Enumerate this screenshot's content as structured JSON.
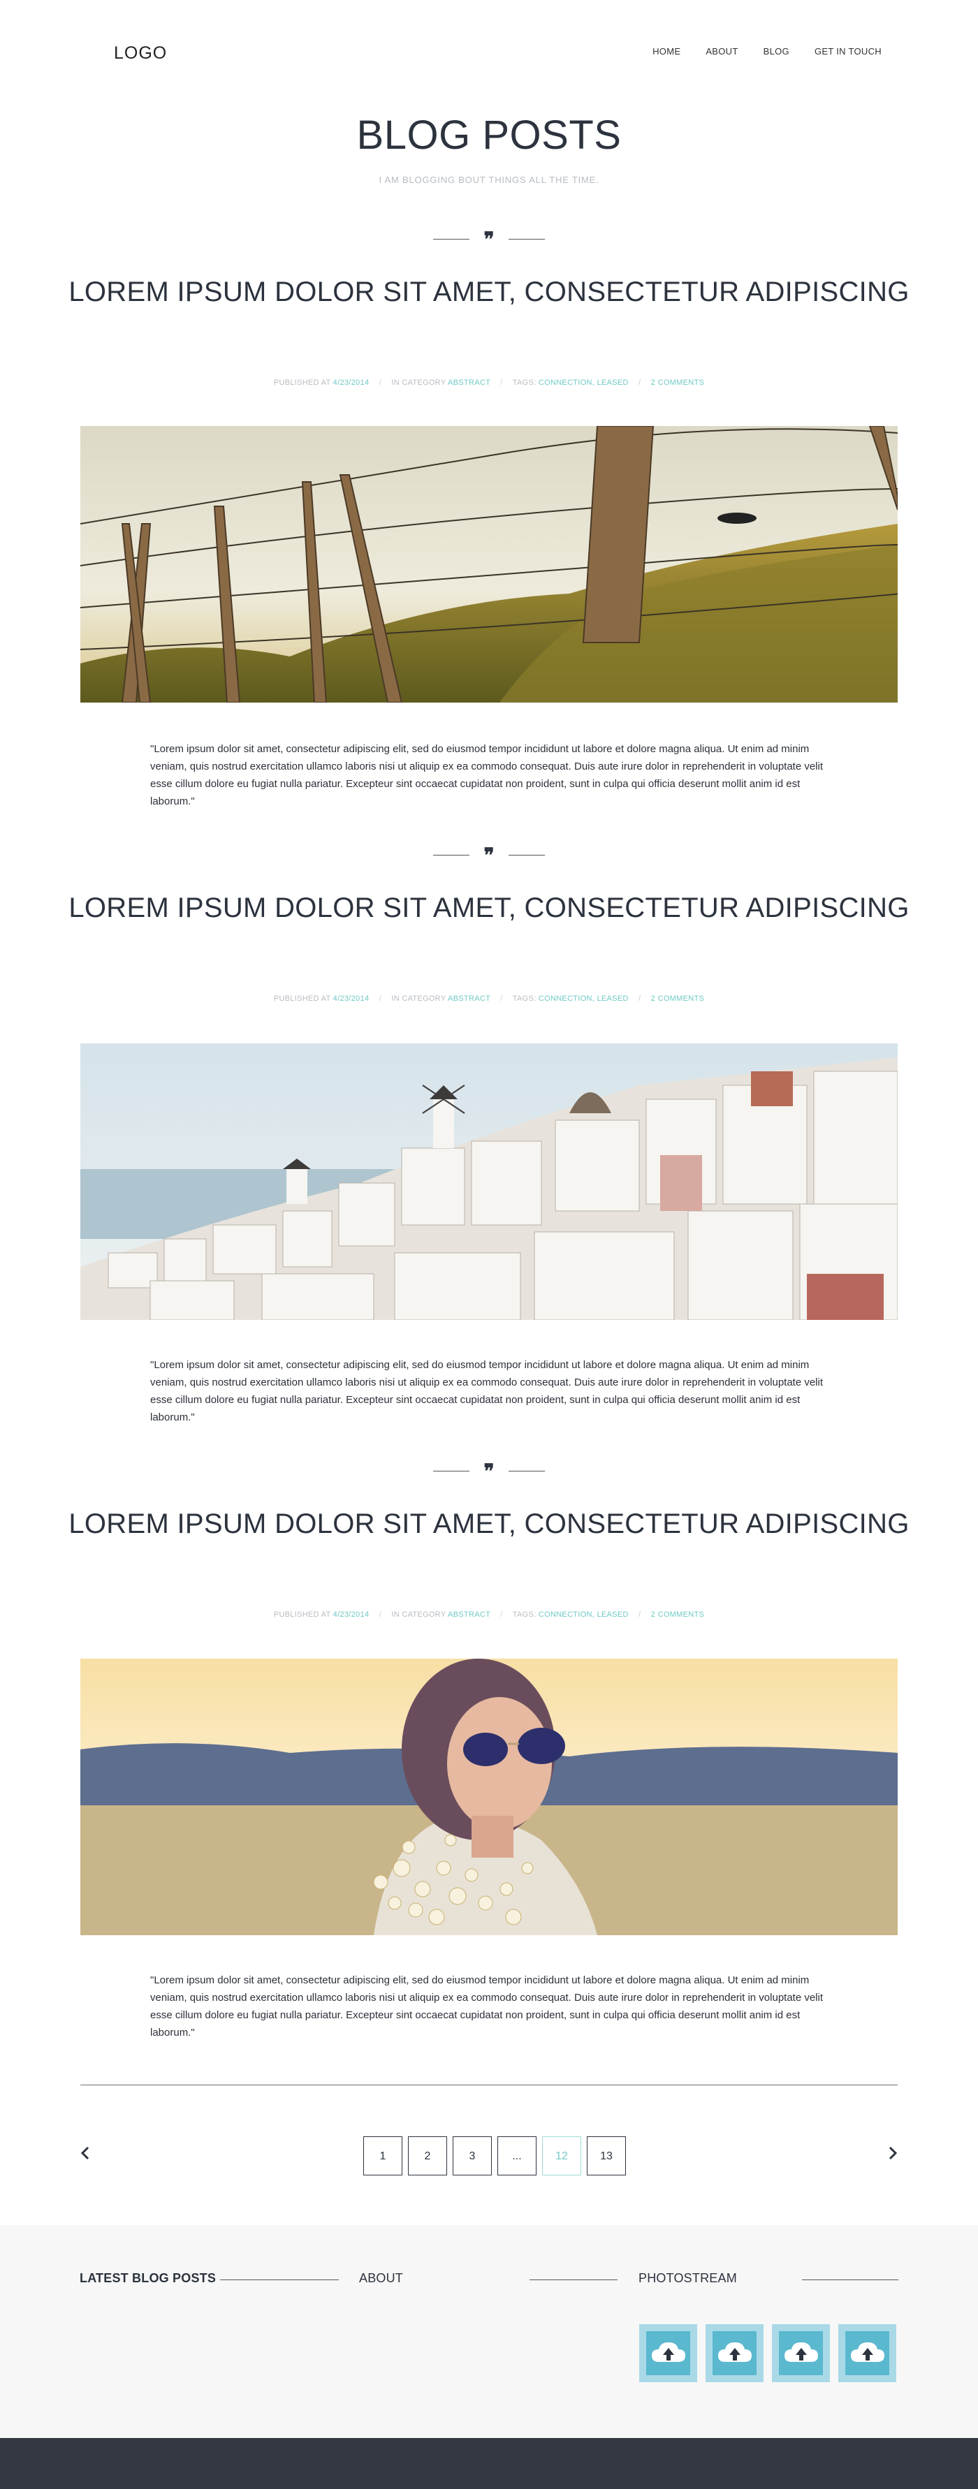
{
  "header": {
    "logo": "LOGO",
    "nav": [
      "HOME",
      "ABOUT",
      "BLOG",
      "GET IN TOUCH"
    ]
  },
  "page": {
    "title": "BLOG POSTS",
    "subtitle": "I AM BLOGGING BOUT THINGS ALL THE TIME."
  },
  "posts": [
    {
      "quote_glyph": "❞",
      "title": "LOREM IPSUM DOLOR SIT AMET, CONSECTETUR ADIPISCING",
      "meta": {
        "published_label": "PUBLISHED AT",
        "date": "4/23/2014",
        "category_label": "IN CATEGORY",
        "category": "ABSTRACT",
        "tags_label": "TAGS:",
        "tags": "CONNECTION, LEASED",
        "comments": "2 COMMENTS",
        "separator": "/"
      },
      "image": "barbed-wire-fence-photo",
      "excerpt": "\"Lorem ipsum dolor sit amet, consectetur adipiscing elit, sed do eiusmod tempor incididunt ut labore et dolore magna aliqua. Ut enim ad minim veniam, quis nostrud exercitation ullamco laboris nisi ut aliquip ex ea commodo consequat. Duis aute irure dolor in reprehenderit in voluptate velit esse cillum dolore eu fugiat nulla pariatur. Excepteur sint occaecat cupidatat non proident, sunt in culpa qui officia deserunt mollit anim id est laborum.\""
    },
    {
      "quote_glyph": "❞",
      "title": "LOREM IPSUM DOLOR SIT AMET, CONSECTETUR ADIPISCING",
      "meta": {
        "published_label": "PUBLISHED AT",
        "date": "4/23/2014",
        "category_label": "IN CATEGORY",
        "category": "ABSTRACT",
        "tags_label": "TAGS:",
        "tags": "CONNECTION, LEASED",
        "comments": "2 COMMENTS",
        "separator": "/"
      },
      "image": "santorini-village-photo",
      "excerpt": "\"Lorem ipsum dolor sit amet, consectetur adipiscing elit, sed do eiusmod tempor incididunt ut labore et dolore magna aliqua. Ut enim ad minim veniam, quis nostrud exercitation ullamco laboris nisi ut aliquip ex ea commodo consequat. Duis aute irure dolor in reprehenderit in voluptate velit esse cillum dolore eu fugiat nulla pariatur. Excepteur sint occaecat cupidatat non proident, sunt in culpa qui officia deserunt mollit anim id est laborum.\""
    },
    {
      "quote_glyph": "❞",
      "title": "LOREM IPSUM DOLOR SIT AMET, CONSECTETUR ADIPISCING",
      "meta": {
        "published_label": "PUBLISHED AT",
        "date": "4/23/2014",
        "category_label": "IN CATEGORY",
        "category": "ABSTRACT",
        "tags_label": "TAGS:",
        "tags": "CONNECTION, LEASED",
        "comments": "2 COMMENTS",
        "separator": "/"
      },
      "image": "woman-sunglasses-flowers-photo",
      "excerpt": "\"Lorem ipsum dolor sit amet, consectetur adipiscing elit, sed do eiusmod tempor incididunt ut labore et dolore magna aliqua. Ut enim ad minim veniam, quis nostrud exercitation ullamco laboris nisi ut aliquip ex ea commodo consequat. Duis aute irure dolor in reprehenderit in voluptate velit esse cillum dolore eu fugiat nulla pariatur. Excepteur sint occaecat cupidatat non proident, sunt in culpa qui officia deserunt mollit anim id est laborum.\""
    }
  ],
  "pagination": {
    "prev_icon": "chevron-left-icon",
    "next_icon": "chevron-right-icon",
    "pages": [
      "1",
      "2",
      "3",
      "...",
      "12",
      "13"
    ],
    "current": "12"
  },
  "widgets": {
    "latest": "LATEST BLOG POSTS",
    "about": "ABOUT",
    "photostream": "PHOTOSTREAM",
    "photo_icon": "cloud-upload-icon",
    "photo_count": 4
  },
  "colors": {
    "accent": "#6fc9c4",
    "text": "#2c333e",
    "muted": "#b7bcc2",
    "footer": "#333843",
    "widget_bg": "#f7f7f7",
    "photo_tile": "#5ab8cf"
  }
}
